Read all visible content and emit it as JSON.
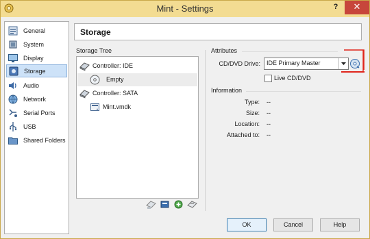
{
  "window": {
    "title": "Mint - Settings"
  },
  "titlebar": {
    "help_glyph": "?",
    "close_glyph": "✕"
  },
  "sidebar": {
    "items": [
      {
        "label": "General",
        "icon": "general-icon"
      },
      {
        "label": "System",
        "icon": "system-icon"
      },
      {
        "label": "Display",
        "icon": "display-icon"
      },
      {
        "label": "Storage",
        "icon": "storage-icon",
        "selected": true
      },
      {
        "label": "Audio",
        "icon": "audio-icon"
      },
      {
        "label": "Network",
        "icon": "network-icon"
      },
      {
        "label": "Serial Ports",
        "icon": "serial-ports-icon"
      },
      {
        "label": "USB",
        "icon": "usb-icon"
      },
      {
        "label": "Shared Folders",
        "icon": "shared-folders-icon"
      }
    ]
  },
  "page": {
    "title": "Storage"
  },
  "storage_tree": {
    "label": "Storage Tree",
    "items": [
      {
        "label": "Controller: IDE",
        "kind": "controller"
      },
      {
        "label": "Empty",
        "kind": "optical",
        "selected": true
      },
      {
        "label": "Controller: SATA",
        "kind": "controller"
      },
      {
        "label": "Mint.vmdk",
        "kind": "disk"
      }
    ]
  },
  "attributes": {
    "section_label": "Attributes",
    "drive_label": "CD/DVD Drive:",
    "drive_value": "IDE Primary Master",
    "live_cd_label": "Live CD/DVD",
    "live_cd_checked": false
  },
  "information": {
    "section_label": "Information",
    "rows": [
      {
        "label": "Type:",
        "value": "--"
      },
      {
        "label": "Size:",
        "value": "--"
      },
      {
        "label": "Location:",
        "value": "--"
      },
      {
        "label": "Attached to:",
        "value": "--"
      }
    ]
  },
  "buttons": {
    "ok": "OK",
    "cancel": "Cancel",
    "help": "Help"
  },
  "colors": {
    "titlebar": "#f3dc92",
    "selection": "#cde2f8",
    "annotation": "#e0241b",
    "close": "#c7463b"
  }
}
